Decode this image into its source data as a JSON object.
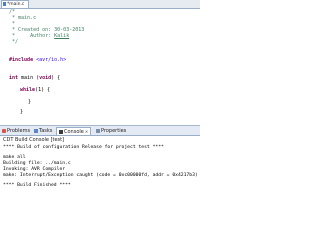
{
  "editor": {
    "tab_label": "*main.c",
    "code": {
      "l1": "/*",
      "l2": " * main.c",
      "l3": " *",
      "l4_prefix": " * Created on: ",
      "l4_date": "30-03-2013",
      "l5_prefix": " *     Author: ",
      "l5_author": "Kalik",
      "l6": " */",
      "l7_directive": "#include",
      "l7_file": " <avr/io.h>",
      "l8_kw": "int",
      "l8_rest": " main (",
      "l8_kw2": "void",
      "l8_end": ") {",
      "l9_kw": "while",
      "l9_rest": "(1) {",
      "l10": "}",
      "l11": "}"
    }
  },
  "views": {
    "tabs": [
      {
        "label": "Problems",
        "icon": "problems-icon"
      },
      {
        "label": "Tasks",
        "icon": "tasks-icon"
      },
      {
        "label": "Console",
        "icon": "console-icon",
        "close": "✕"
      },
      {
        "label": "Properties",
        "icon": "properties-icon"
      }
    ]
  },
  "console": {
    "title": "CDT Build Console [test]",
    "lines": [
      "**** Build of configuration Release for project test ****",
      "make all",
      "Building file: ../main.c",
      "Invoking: AVR Compiler",
      "make: Interrupt/Exception caught (code = 0xc00000fd, addr = 0x4217b3)",
      "**** Build Finished ****"
    ]
  },
  "colors": {
    "comment": "#3f7f5f",
    "keyword": "#7f0055",
    "include_path": "#2a00ff",
    "tab_border": "#9aaec8"
  }
}
